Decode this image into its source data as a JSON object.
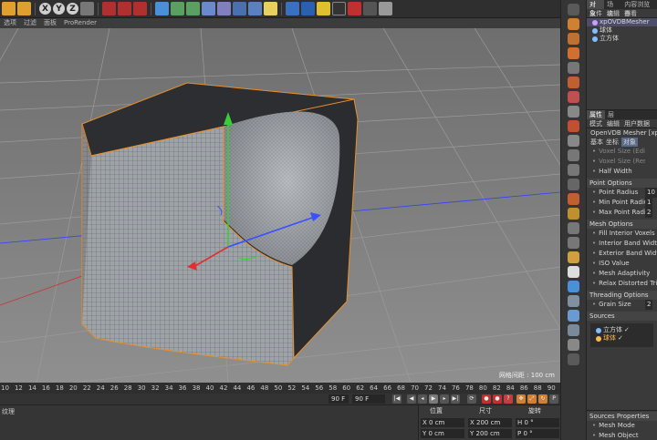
{
  "toolbar": {
    "axis_buttons": [
      "X",
      "Y",
      "Z"
    ]
  },
  "viewport_menu": [
    "选项",
    "过滤",
    "面板",
    "ProRender"
  ],
  "viewport": {
    "grid_spacing": "网格间距 : 100 cm"
  },
  "object_manager": {
    "tabs": [
      "对象",
      "场次",
      "内容浏览器"
    ],
    "menu": [
      "文件",
      "编辑",
      "查看"
    ],
    "objects": [
      {
        "name": "xpOVDBMesher",
        "color": "#c9a0ff",
        "selected": true
      },
      {
        "name": "球体",
        "color": "#7fbfff",
        "selected": false
      },
      {
        "name": "立方体",
        "color": "#7fbfff",
        "selected": false
      }
    ]
  },
  "attribute_manager": {
    "tabs": [
      "属性",
      "层"
    ],
    "menu": [
      "模式",
      "编辑",
      "用户数据"
    ],
    "object_title": "OpenVDB Mesher [xp",
    "subtabs": [
      "基本",
      "坐标",
      "对象"
    ],
    "params_top": [
      {
        "label": "Voxel Size (Editor)",
        "value": "",
        "dim": true
      },
      {
        "label": "Voxel Size (Render)",
        "value": "",
        "dim": true
      },
      {
        "label": "Half Width",
        "value": "",
        "dim": false
      }
    ],
    "point_options": {
      "title": "Point Options",
      "params": [
        {
          "label": "Point Radius",
          "value": "10"
        },
        {
          "label": "Min Point Radius",
          "value": "1"
        },
        {
          "label": "Max Point Radius",
          "value": "2"
        }
      ]
    },
    "mesh_options": {
      "title": "Mesh Options",
      "params": [
        "Fill Interior Voxels",
        "Interior Band Width",
        "Exterior Band Width",
        "ISO Value",
        "Mesh Adaptivity",
        "Relax Distorted Trian"
      ]
    },
    "threading_options": {
      "title": "Threading Options",
      "params": [
        {
          "label": "Grain Size",
          "value": "2"
        }
      ]
    },
    "sources": {
      "title": "Sources",
      "items": [
        {
          "name": "立方体",
          "color": "#7fbfff",
          "checked": "✓"
        },
        {
          "name": "球体",
          "color": "#ffb84d",
          "checked": "✓"
        }
      ]
    }
  },
  "sources_properties": {
    "title": "Sources Properties",
    "params": [
      "Mesh Mode",
      "Mesh Object"
    ]
  },
  "timeline": {
    "ticks": [
      "10",
      "12",
      "14",
      "16",
      "18",
      "20",
      "22",
      "24",
      "26",
      "28",
      "30",
      "32",
      "34",
      "36",
      "38",
      "40",
      "42",
      "44",
      "46",
      "48",
      "50",
      "52",
      "54",
      "56",
      "58",
      "60",
      "62",
      "64",
      "66",
      "68",
      "70",
      "72",
      "74",
      "76",
      "78",
      "80",
      "82",
      "84",
      "86",
      "88",
      "90"
    ],
    "end_frame_left": "90 F",
    "end_frame_right": "90 F"
  },
  "material_panel": {
    "label": "纹理"
  },
  "coordinates": {
    "headers": [
      "位置",
      "尺寸",
      "旋转"
    ],
    "position": [
      "X 0 cm",
      "Y 0 cm"
    ],
    "size": [
      "X 200 cm",
      "Y 200 cm"
    ],
    "rotation": [
      "H 0 °",
      "P 0 °"
    ]
  }
}
